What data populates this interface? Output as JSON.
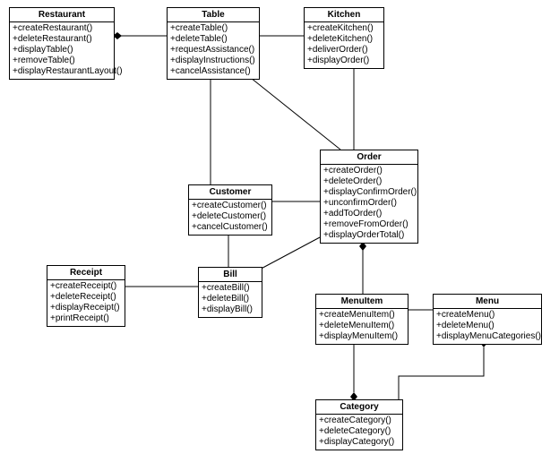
{
  "classes": {
    "restaurant": {
      "name": "Restaurant",
      "methods": [
        "+createRestaurant()",
        "+deleteRestaurant()",
        "+displayTable()",
        "+removeTable()",
        "+displayRestaurantLayout()"
      ]
    },
    "table": {
      "name": "Table",
      "methods": [
        "+createTable()",
        "+deleteTable()",
        "+requestAssistance()",
        "+displayInstructions()",
        "+cancelAssistance()"
      ]
    },
    "kitchen": {
      "name": "Kitchen",
      "methods": [
        "+createKitchen()",
        "+deleteKitchen()",
        "+deliverOrder()",
        "+displayOrder()"
      ]
    },
    "customer": {
      "name": "Customer",
      "methods": [
        "+createCustomer()",
        "+deleteCustomer()",
        "+cancelCustomer()"
      ]
    },
    "order": {
      "name": "Order",
      "methods": [
        "+createOrder()",
        "+deleteOrder()",
        "+displayConfirmOrder()",
        "+unconfirmOrder()",
        "+addToOrder()",
        "+removeFromOrder()",
        "+displayOrderTotal()"
      ]
    },
    "receipt": {
      "name": "Receipt",
      "methods": [
        "+createReceipt()",
        "+deleteReceipt()",
        "+displayReceipt()",
        "+printReceipt()"
      ]
    },
    "bill": {
      "name": "Bill",
      "methods": [
        "+createBill()",
        "+deleteBill()",
        "+displayBill()"
      ]
    },
    "menuitem": {
      "name": "MenuItem",
      "methods": [
        "+createMenuItem()",
        "+deleteMenuItem()",
        "+displayMenuItem()"
      ]
    },
    "menu": {
      "name": "Menu",
      "methods": [
        "+createMenu()",
        "+deleteMenu()",
        "+displayMenuCategories()"
      ]
    },
    "category": {
      "name": "Category",
      "methods": [
        "+createCategory()",
        "+deleteCategory()",
        "+displayCategory()"
      ]
    }
  },
  "chart_data": {
    "type": "uml-class-diagram",
    "classes": [
      {
        "name": "Restaurant",
        "methods": [
          "createRestaurant()",
          "deleteRestaurant()",
          "displayTable()",
          "removeTable()",
          "displayRestaurantLayout()"
        ]
      },
      {
        "name": "Table",
        "methods": [
          "createTable()",
          "deleteTable()",
          "requestAssistance()",
          "displayInstructions()",
          "cancelAssistance()"
        ]
      },
      {
        "name": "Kitchen",
        "methods": [
          "createKitchen()",
          "deleteKitchen()",
          "deliverOrder()",
          "displayOrder()"
        ]
      },
      {
        "name": "Customer",
        "methods": [
          "createCustomer()",
          "deleteCustomer()",
          "cancelCustomer()"
        ]
      },
      {
        "name": "Order",
        "methods": [
          "createOrder()",
          "deleteOrder()",
          "displayConfirmOrder()",
          "unconfirmOrder()",
          "addToOrder()",
          "removeFromOrder()",
          "displayOrderTotal()"
        ]
      },
      {
        "name": "Receipt",
        "methods": [
          "createReceipt()",
          "deleteReceipt()",
          "displayReceipt()",
          "printReceipt()"
        ]
      },
      {
        "name": "Bill",
        "methods": [
          "createBill()",
          "deleteBill()",
          "displayBill()"
        ]
      },
      {
        "name": "MenuItem",
        "methods": [
          "createMenuItem()",
          "deleteMenuItem()",
          "displayMenuItem()"
        ]
      },
      {
        "name": "Menu",
        "methods": [
          "createMenu()",
          "deleteMenu()",
          "displayMenuCategories()"
        ]
      },
      {
        "name": "Category",
        "methods": [
          "createCategory()",
          "deleteCategory()",
          "displayCategory()"
        ]
      }
    ],
    "relationships": [
      {
        "from": "Restaurant",
        "to": "Table",
        "type": "composition",
        "whole": "Restaurant"
      },
      {
        "from": "Table",
        "to": "Kitchen",
        "type": "association"
      },
      {
        "from": "Table",
        "to": "Customer",
        "type": "association"
      },
      {
        "from": "Table",
        "to": "Order",
        "type": "association"
      },
      {
        "from": "Kitchen",
        "to": "Order",
        "type": "association"
      },
      {
        "from": "Customer",
        "to": "Order",
        "type": "association"
      },
      {
        "from": "Customer",
        "to": "Bill",
        "type": "association"
      },
      {
        "from": "Bill",
        "to": "Receipt",
        "type": "association"
      },
      {
        "from": "Bill",
        "to": "Order",
        "type": "association"
      },
      {
        "from": "Order",
        "to": "MenuItem",
        "type": "composition",
        "whole": "Order"
      },
      {
        "from": "Menu",
        "to": "Category",
        "type": "composition",
        "whole": "Menu"
      },
      {
        "from": "Category",
        "to": "MenuItem",
        "type": "composition",
        "whole": "Category"
      },
      {
        "from": "MenuItem",
        "to": "Menu",
        "type": "association"
      }
    ]
  }
}
